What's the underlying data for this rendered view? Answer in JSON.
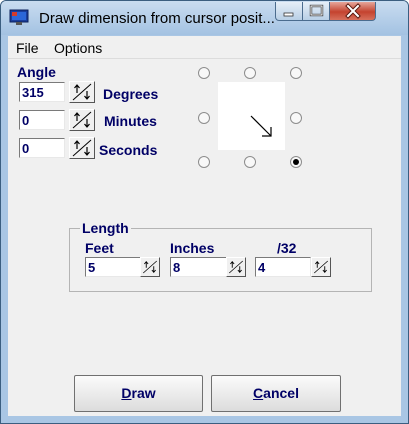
{
  "window": {
    "title": "Draw dimension from cursor posit...",
    "icon": "monitor-app-icon",
    "controls": [
      "minimize-icon",
      "maximize-icon",
      "close-icon"
    ]
  },
  "menu": {
    "items": [
      "File",
      "Options"
    ]
  },
  "angle": {
    "heading": "Angle",
    "degrees": {
      "value": "315",
      "label": "Degrees"
    },
    "minutes": {
      "value": "0",
      "label": "Minutes"
    },
    "seconds": {
      "value": "0",
      "label": "Seconds"
    }
  },
  "direction": {
    "options": [
      "up-left",
      "up",
      "up-right",
      "left",
      "right",
      "down-left",
      "down",
      "down-right"
    ],
    "selected": "down-right",
    "preview_icon": "arrow-down-right-icon"
  },
  "length": {
    "heading": "Length",
    "feet": {
      "label": "Feet",
      "value": "5"
    },
    "inches": {
      "label": "Inches",
      "value": "8"
    },
    "fraction": {
      "label": "/32",
      "value": "4"
    }
  },
  "buttons": {
    "draw": {
      "mnemonic": "D",
      "rest": "raw"
    },
    "cancel": {
      "mnemonic": "C",
      "rest": "ancel"
    }
  }
}
